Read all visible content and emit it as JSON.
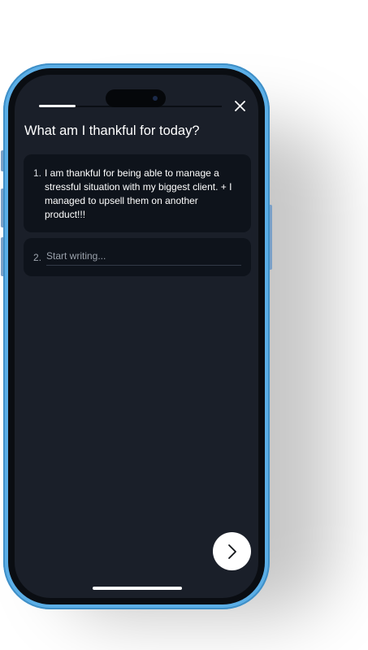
{
  "colors": {
    "device_frame": "#5baee6",
    "screen_background": "#1a1f29",
    "card_background": "#0e131b",
    "text_primary": "#ffffff",
    "placeholder": "#9aa1ab",
    "next_button_background": "#ffffff"
  },
  "progress": {
    "value": 0.2
  },
  "header": {
    "close_icon": "close-icon"
  },
  "prompt": {
    "title": "What am I thankful for today?"
  },
  "entries": [
    {
      "number": "1.",
      "text": "I am thankful for being able to manage a stressful situation with my biggest client. + I managed to upsell them on another product!!!"
    },
    {
      "number": "2.",
      "value": "",
      "placeholder": "Start writing..."
    }
  ],
  "footer": {
    "next_icon": "chevron-right-icon"
  }
}
